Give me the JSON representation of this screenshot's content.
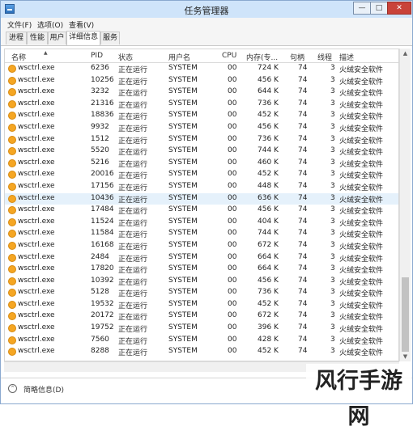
{
  "window": {
    "title": "任务管理器"
  },
  "titlebar_buttons": {
    "minimize": "—",
    "maximize": "□",
    "close": "✕"
  },
  "menu": [
    "文件(F)",
    "选项(O)",
    "查看(V)"
  ],
  "tabs": [
    "进程",
    "性能",
    "用户",
    "详细信息",
    "服务"
  ],
  "active_tab": "详细信息",
  "columns": [
    "名称",
    "PID",
    "状态",
    "用户名",
    "CPU",
    "内存(专...",
    "句柄",
    "线程",
    "描述"
  ],
  "rows": [
    {
      "name": "wsctrl.exe",
      "pid": "6236",
      "status": "正在运行",
      "user": "SYSTEM",
      "cpu": "00",
      "mem": "724 K",
      "handles": "74",
      "threads": "3",
      "desc": "火绒安全软件"
    },
    {
      "name": "wsctrl.exe",
      "pid": "10256",
      "status": "正在运行",
      "user": "SYSTEM",
      "cpu": "00",
      "mem": "456 K",
      "handles": "74",
      "threads": "3",
      "desc": "火绒安全软件"
    },
    {
      "name": "wsctrl.exe",
      "pid": "3232",
      "status": "正在运行",
      "user": "SYSTEM",
      "cpu": "00",
      "mem": "644 K",
      "handles": "74",
      "threads": "3",
      "desc": "火绒安全软件"
    },
    {
      "name": "wsctrl.exe",
      "pid": "21316",
      "status": "正在运行",
      "user": "SYSTEM",
      "cpu": "00",
      "mem": "736 K",
      "handles": "74",
      "threads": "3",
      "desc": "火绒安全软件"
    },
    {
      "name": "wsctrl.exe",
      "pid": "18836",
      "status": "正在运行",
      "user": "SYSTEM",
      "cpu": "00",
      "mem": "452 K",
      "handles": "74",
      "threads": "3",
      "desc": "火绒安全软件"
    },
    {
      "name": "wsctrl.exe",
      "pid": "9932",
      "status": "正在运行",
      "user": "SYSTEM",
      "cpu": "00",
      "mem": "456 K",
      "handles": "74",
      "threads": "3",
      "desc": "火绒安全软件"
    },
    {
      "name": "wsctrl.exe",
      "pid": "1512",
      "status": "正在运行",
      "user": "SYSTEM",
      "cpu": "00",
      "mem": "736 K",
      "handles": "74",
      "threads": "3",
      "desc": "火绒安全软件"
    },
    {
      "name": "wsctrl.exe",
      "pid": "5520",
      "status": "正在运行",
      "user": "SYSTEM",
      "cpu": "00",
      "mem": "744 K",
      "handles": "74",
      "threads": "3",
      "desc": "火绒安全软件"
    },
    {
      "name": "wsctrl.exe",
      "pid": "5216",
      "status": "正在运行",
      "user": "SYSTEM",
      "cpu": "00",
      "mem": "460 K",
      "handles": "74",
      "threads": "3",
      "desc": "火绒安全软件"
    },
    {
      "name": "wsctrl.exe",
      "pid": "20016",
      "status": "正在运行",
      "user": "SYSTEM",
      "cpu": "00",
      "mem": "452 K",
      "handles": "74",
      "threads": "3",
      "desc": "火绒安全软件"
    },
    {
      "name": "wsctrl.exe",
      "pid": "17156",
      "status": "正在运行",
      "user": "SYSTEM",
      "cpu": "00",
      "mem": "448 K",
      "handles": "74",
      "threads": "3",
      "desc": "火绒安全软件"
    },
    {
      "name": "wsctrl.exe",
      "pid": "10436",
      "status": "正在运行",
      "user": "SYSTEM",
      "cpu": "00",
      "mem": "636 K",
      "handles": "74",
      "threads": "3",
      "desc": "火绒安全软件"
    },
    {
      "name": "wsctrl.exe",
      "pid": "17484",
      "status": "正在运行",
      "user": "SYSTEM",
      "cpu": "00",
      "mem": "456 K",
      "handles": "74",
      "threads": "3",
      "desc": "火绒安全软件"
    },
    {
      "name": "wsctrl.exe",
      "pid": "11524",
      "status": "正在运行",
      "user": "SYSTEM",
      "cpu": "00",
      "mem": "404 K",
      "handles": "74",
      "threads": "3",
      "desc": "火绒安全软件"
    },
    {
      "name": "wsctrl.exe",
      "pid": "11584",
      "status": "正在运行",
      "user": "SYSTEM",
      "cpu": "00",
      "mem": "744 K",
      "handles": "74",
      "threads": "3",
      "desc": "火绒安全软件"
    },
    {
      "name": "wsctrl.exe",
      "pid": "16168",
      "status": "正在运行",
      "user": "SYSTEM",
      "cpu": "00",
      "mem": "672 K",
      "handles": "74",
      "threads": "3",
      "desc": "火绒安全软件"
    },
    {
      "name": "wsctrl.exe",
      "pid": "2484",
      "status": "正在运行",
      "user": "SYSTEM",
      "cpu": "00",
      "mem": "664 K",
      "handles": "74",
      "threads": "3",
      "desc": "火绒安全软件"
    },
    {
      "name": "wsctrl.exe",
      "pid": "17820",
      "status": "正在运行",
      "user": "SYSTEM",
      "cpu": "00",
      "mem": "664 K",
      "handles": "74",
      "threads": "3",
      "desc": "火绒安全软件"
    },
    {
      "name": "wsctrl.exe",
      "pid": "10392",
      "status": "正在运行",
      "user": "SYSTEM",
      "cpu": "00",
      "mem": "456 K",
      "handles": "74",
      "threads": "3",
      "desc": "火绒安全软件"
    },
    {
      "name": "wsctrl.exe",
      "pid": "5128",
      "status": "正在运行",
      "user": "SYSTEM",
      "cpu": "00",
      "mem": "736 K",
      "handles": "74",
      "threads": "3",
      "desc": "火绒安全软件"
    },
    {
      "name": "wsctrl.exe",
      "pid": "19532",
      "status": "正在运行",
      "user": "SYSTEM",
      "cpu": "00",
      "mem": "452 K",
      "handles": "74",
      "threads": "3",
      "desc": "火绒安全软件"
    },
    {
      "name": "wsctrl.exe",
      "pid": "20172",
      "status": "正在运行",
      "user": "SYSTEM",
      "cpu": "00",
      "mem": "672 K",
      "handles": "74",
      "threads": "3",
      "desc": "火绒安全软件"
    },
    {
      "name": "wsctrl.exe",
      "pid": "19752",
      "status": "正在运行",
      "user": "SYSTEM",
      "cpu": "00",
      "mem": "396 K",
      "handles": "74",
      "threads": "3",
      "desc": "火绒安全软件"
    },
    {
      "name": "wsctrl.exe",
      "pid": "7560",
      "status": "正在运行",
      "user": "SYSTEM",
      "cpu": "00",
      "mem": "428 K",
      "handles": "74",
      "threads": "3",
      "desc": "火绒安全软件"
    },
    {
      "name": "wsctrl.exe",
      "pid": "8288",
      "status": "正在运行",
      "user": "SYSTEM",
      "cpu": "00",
      "mem": "452 K",
      "handles": "74",
      "threads": "3",
      "desc": "火绒安全软件"
    }
  ],
  "selected_row_pid": "10436",
  "status": {
    "toggle_icon": "⌃",
    "label": "简略信息(D)"
  },
  "watermark": "风行手游网",
  "colors": {
    "titlebar": "#cfe4fa",
    "selected_row": "#e5f1fb",
    "process_icon": "#f5a623",
    "close_button": "#c9433a"
  }
}
